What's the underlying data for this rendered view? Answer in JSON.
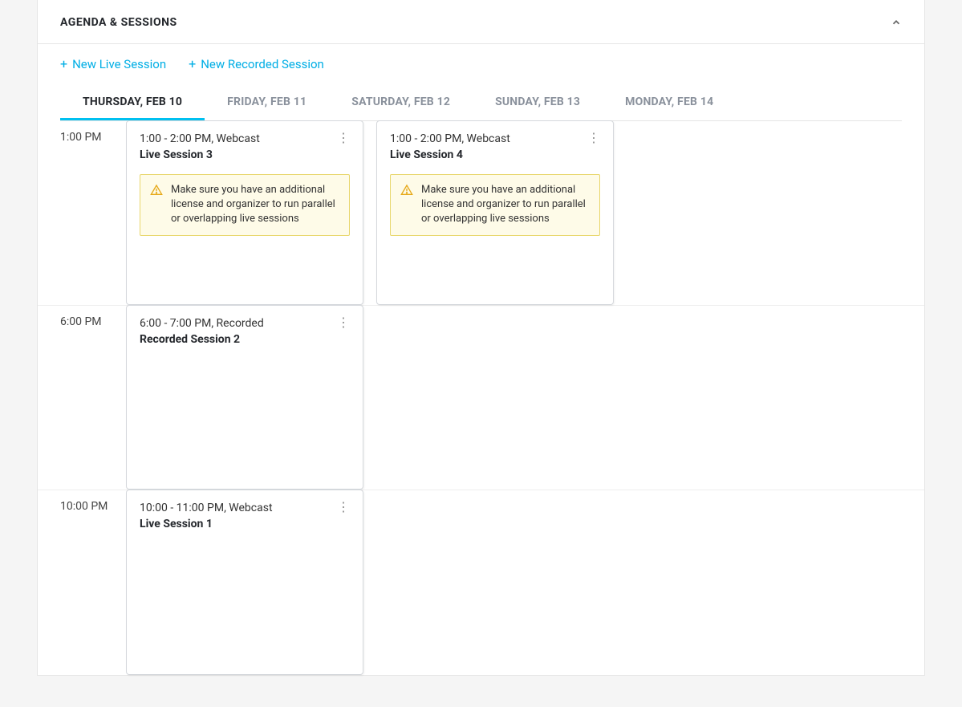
{
  "panel": {
    "title": "AGENDA & SESSIONS"
  },
  "toolbar": {
    "new_live_label": "New Live Session",
    "new_recorded_label": "New Recorded Session"
  },
  "tabs": [
    {
      "label": "THURSDAY, FEB 10",
      "active": true
    },
    {
      "label": "FRIDAY, FEB 11",
      "active": false
    },
    {
      "label": "SATURDAY, FEB 12",
      "active": false
    },
    {
      "label": "SUNDAY, FEB 13",
      "active": false
    },
    {
      "label": "MONDAY, FEB 14",
      "active": false
    }
  ],
  "warning_text": "Make sure you have an additional license and organizer to run parallel or overlapping live sessions",
  "time_rows": [
    {
      "label": "1:00 PM",
      "sessions": [
        {
          "time_label": "1:00 - 2:00 PM, Webcast",
          "title": "Live Session 3",
          "warning": true
        },
        {
          "time_label": "1:00 - 2:00 PM, Webcast",
          "title": "Live Session 4",
          "warning": true
        }
      ]
    },
    {
      "label": "6:00 PM",
      "sessions": [
        {
          "time_label": "6:00 - 7:00 PM, Recorded",
          "title": "Recorded Session 2",
          "warning": false
        }
      ]
    },
    {
      "label": "10:00 PM",
      "sessions": [
        {
          "time_label": "10:00 - 11:00 PM, Webcast",
          "title": "Live Session 1",
          "warning": false
        }
      ]
    }
  ]
}
